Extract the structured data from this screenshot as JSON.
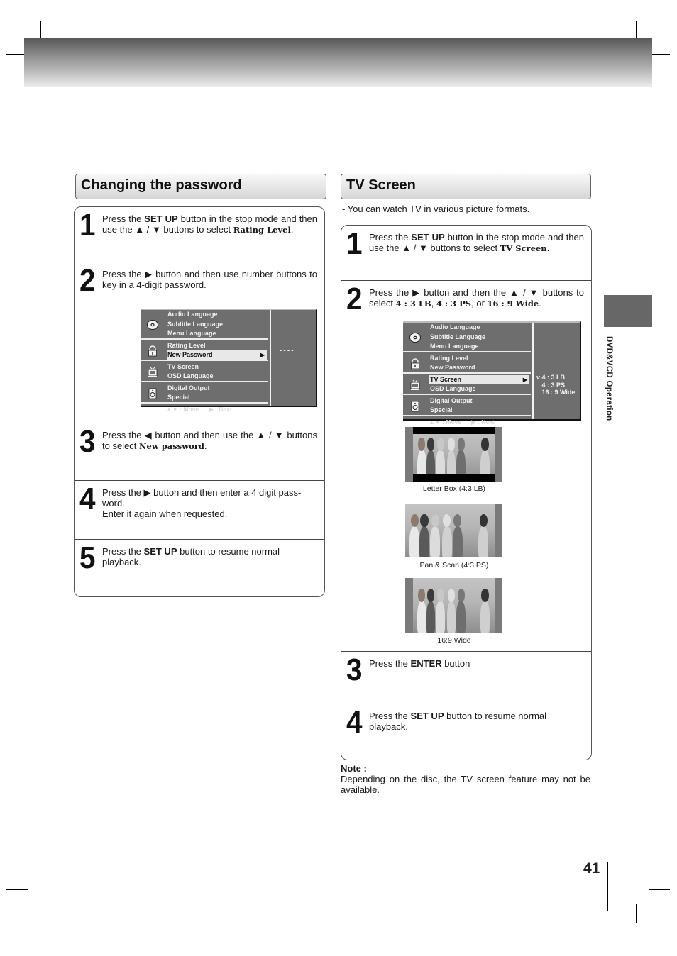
{
  "page": {
    "number": "41",
    "side_label": "DVD&VCD Operation"
  },
  "password_section": {
    "title": "Changing the password",
    "steps": [
      {
        "num": "1",
        "parts": [
          {
            "t": "Press the ",
            "s": ""
          },
          {
            "t": "SET UP",
            "s": "b"
          },
          {
            "t": " button in the stop mode and then use the ▲ / ▼  buttons to select ",
            "s": ""
          },
          {
            "t": "Rating Level",
            "s": "serif"
          },
          {
            "t": ".",
            "s": ""
          }
        ]
      },
      {
        "num": "2",
        "parts": [
          {
            "t": "Press the ▶ button and then use number  buttons to key in a 4-digit password.",
            "s": ""
          }
        ]
      },
      {
        "num": "3",
        "parts": [
          {
            "t": "Press the ◀ button and then use the ▲ / ▼ buttons to select ",
            "s": ""
          },
          {
            "t": "New password",
            "s": "serif"
          },
          {
            "t": ".",
            "s": ""
          }
        ]
      },
      {
        "num": "4",
        "parts": [
          {
            "t": "Press the ▶ button and then enter a 4 digit pass-word.",
            "s": ""
          },
          {
            "t": "\nEnter it again when requested.",
            "s": "br"
          }
        ]
      },
      {
        "num": "5",
        "parts": [
          {
            "t": "Press the ",
            "s": ""
          },
          {
            "t": "SET UP",
            "s": "b"
          },
          {
            "t": " button to resume normal playback.",
            "s": ""
          }
        ]
      }
    ],
    "osd": {
      "groups": [
        {
          "icon": "disc-icon",
          "items": [
            "Audio Language",
            "Subtitle Language",
            "Menu Language"
          ]
        },
        {
          "icon": "lock-icon",
          "items": [
            "Rating Level",
            "New Password"
          ]
        },
        {
          "icon": "tv-icon",
          "items": [
            "TV Screen",
            "OSD Language"
          ]
        },
        {
          "icon": "speaker-icon",
          "items": [
            "Digital Output",
            "Special"
          ]
        }
      ],
      "selected": "New Password",
      "footer_move": "▲▼ : Move",
      "footer_next": "▶ : Next",
      "value": "- - - -"
    }
  },
  "tv_section": {
    "title": "TV Screen",
    "intro": "-  You can watch TV in various picture formats.",
    "steps": [
      {
        "num": "1",
        "parts": [
          {
            "t": "Press the ",
            "s": ""
          },
          {
            "t": "SET UP",
            "s": "b"
          },
          {
            "t": " button in the stop mode and then use the ▲ / ▼  buttons to select ",
            "s": ""
          },
          {
            "t": "TV Screen",
            "s": "serif"
          },
          {
            "t": ".",
            "s": ""
          }
        ]
      },
      {
        "num": "2",
        "parts": [
          {
            "t": "Press the ▶ button and then the ▲ / ▼  buttons to select ",
            "s": ""
          },
          {
            "t": "4 : 3 LB",
            "s": "serif"
          },
          {
            "t": ", ",
            "s": ""
          },
          {
            "t": "4 : 3 PS",
            "s": "serif"
          },
          {
            "t": ", or ",
            "s": ""
          },
          {
            "t": "16 : 9 Wide",
            "s": "serif"
          },
          {
            "t": ".",
            "s": ""
          }
        ]
      },
      {
        "num": "3",
        "parts": [
          {
            "t": "Press the ",
            "s": ""
          },
          {
            "t": "ENTER",
            "s": "b"
          },
          {
            "t": " button",
            "s": ""
          }
        ]
      },
      {
        "num": "4",
        "parts": [
          {
            "t": "Press the ",
            "s": ""
          },
          {
            "t": "SET UP",
            "s": "b"
          },
          {
            "t": " button to resume normal playback.",
            "s": ""
          }
        ]
      }
    ],
    "osd": {
      "groups": [
        {
          "icon": "disc-icon",
          "items": [
            "Audio Language",
            "Subtitle Language",
            "Menu Language"
          ]
        },
        {
          "icon": "lock-icon",
          "items": [
            "Rating Level",
            "New Password"
          ]
        },
        {
          "icon": "tv-icon",
          "items": [
            "TV Screen",
            "OSD Language"
          ]
        },
        {
          "icon": "speaker-icon",
          "items": [
            "Digital Output",
            "Special"
          ]
        }
      ],
      "selected": "TV Screen",
      "footer_move": "▲▼ : Move",
      "footer_next": "▶ : Next",
      "options": [
        "v 4 : 3 LB",
        "   4 : 3 PS",
        "   16 : 9 Wide"
      ]
    },
    "pictures": [
      {
        "caption": "Letter Box (4:3 LB)",
        "mode": "letterbox"
      },
      {
        "caption": "Pan & Scan (4:3 PS)",
        "mode": "panscan"
      },
      {
        "caption": "16:9 Wide",
        "mode": "wide"
      }
    ],
    "note_label": "Note :",
    "note_text": "Depending on the disc, the TV screen feature may not be available."
  }
}
